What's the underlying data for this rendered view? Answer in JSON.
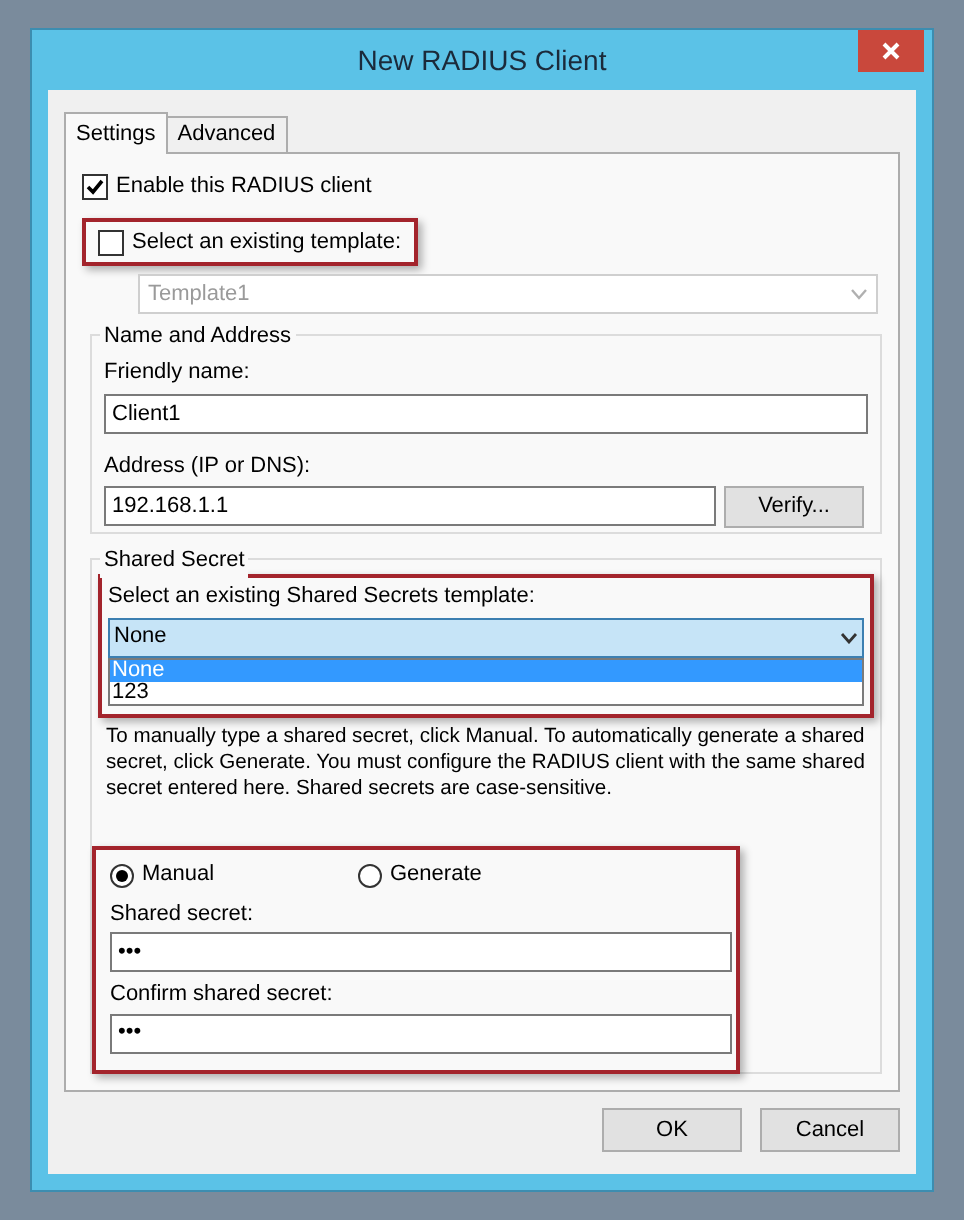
{
  "window": {
    "title": "New RADIUS Client"
  },
  "tabs": [
    {
      "label": "Settings",
      "selected": true
    },
    {
      "label": "Advanced",
      "selected": false
    }
  ],
  "enable_client": {
    "label": "Enable this RADIUS client",
    "checked": true
  },
  "template": {
    "label": "Select an existing template:",
    "checked": false,
    "highlighted": true,
    "dropdown": {
      "value": "Template1",
      "disabled": true
    }
  },
  "name_and_address": {
    "title": "Name and Address",
    "friendly_name": {
      "label": "Friendly name:",
      "value": "Client1"
    },
    "address": {
      "label": "Address (IP or DNS):",
      "value": "192.168.1.1"
    },
    "verify_button": "Verify..."
  },
  "shared_secret": {
    "title": "Shared Secret",
    "template_select": {
      "label": "Select an existing Shared Secrets template:",
      "value": "None",
      "expanded": true,
      "highlighted": true,
      "options": [
        {
          "label": "None",
          "selected": true
        },
        {
          "label": "123",
          "selected": false
        }
      ]
    },
    "description": "To manually type a shared secret, click Manual. To automatically generate a shared secret, click Generate. You must configure the RADIUS client with the same shared secret entered here. Shared secrets are case-sensitive.",
    "mode": {
      "highlighted": true,
      "options": [
        {
          "label": "Manual",
          "selected": true
        },
        {
          "label": "Generate",
          "selected": false
        }
      ],
      "secret": {
        "label": "Shared secret:",
        "value": "•••"
      },
      "confirm": {
        "label": "Confirm shared secret:",
        "value": "•••"
      }
    }
  },
  "buttons": [
    "OK",
    "Cancel"
  ]
}
